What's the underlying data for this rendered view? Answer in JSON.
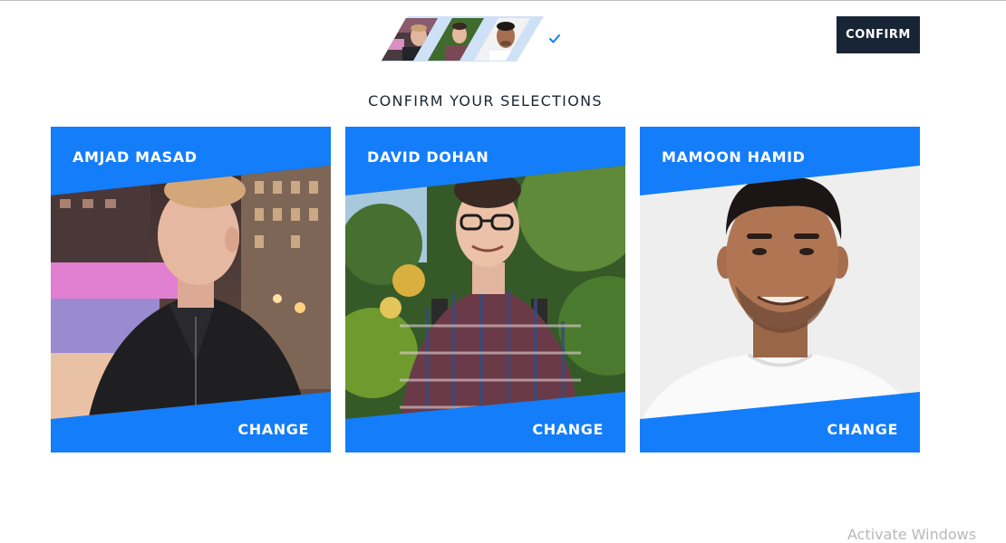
{
  "header": {
    "confirm_label": "CONFIRM",
    "selected_thumbnails": [
      "avatar-amjad-masad",
      "avatar-david-dohan",
      "avatar-mamoon-hamid"
    ],
    "status_icon": "checkmark-icon"
  },
  "main": {
    "title": "CONFIRM YOUR SELECTIONS",
    "cards": [
      {
        "name": "AMJAD MASAD",
        "change_label": "CHANGE"
      },
      {
        "name": "DAVID DOHAN",
        "change_label": "CHANGE"
      },
      {
        "name": "MAMOON HAMID",
        "change_label": "CHANGE"
      }
    ]
  },
  "overlay": {
    "watermark": "Activate Windows"
  },
  "colors": {
    "accent_blue": "#147dfa",
    "confirm_button_bg": "#182536",
    "title_text": "#1d2532",
    "check": "#147dfa"
  }
}
